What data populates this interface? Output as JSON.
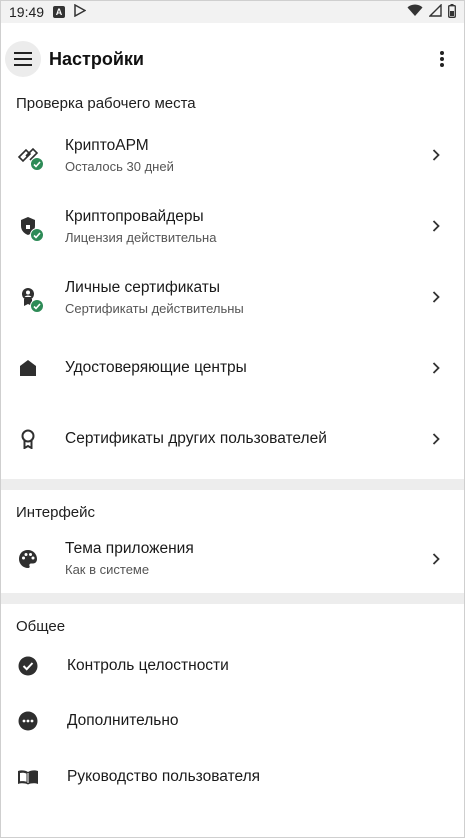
{
  "status_bar": {
    "time": "19:49"
  },
  "app_bar": {
    "title": "Настройки"
  },
  "sections": {
    "workplace": {
      "header": "Проверка рабочего места",
      "items": [
        {
          "title": "КриптоАРМ",
          "subtitle": "Осталось 30 дней"
        },
        {
          "title": "Криптопровайдеры",
          "subtitle": "Лицензия действительна"
        },
        {
          "title": "Личные сертификаты",
          "subtitle": "Сертификаты действительны"
        },
        {
          "title": "Удостоверяющие центры"
        },
        {
          "title": "Сертификаты других пользователей"
        }
      ]
    },
    "interface": {
      "header": "Интерфейс",
      "items": [
        {
          "title": "Тема приложения",
          "subtitle": "Как в системе"
        }
      ]
    },
    "general": {
      "header": "Общее",
      "items": [
        {
          "title": "Контроль целостности"
        },
        {
          "title": "Дополнительно"
        },
        {
          "title": "Руководство пользователя"
        }
      ]
    }
  },
  "colors": {
    "badge": "#2e8b57",
    "divider": "#ededed",
    "icon": "#2f2f2f"
  }
}
